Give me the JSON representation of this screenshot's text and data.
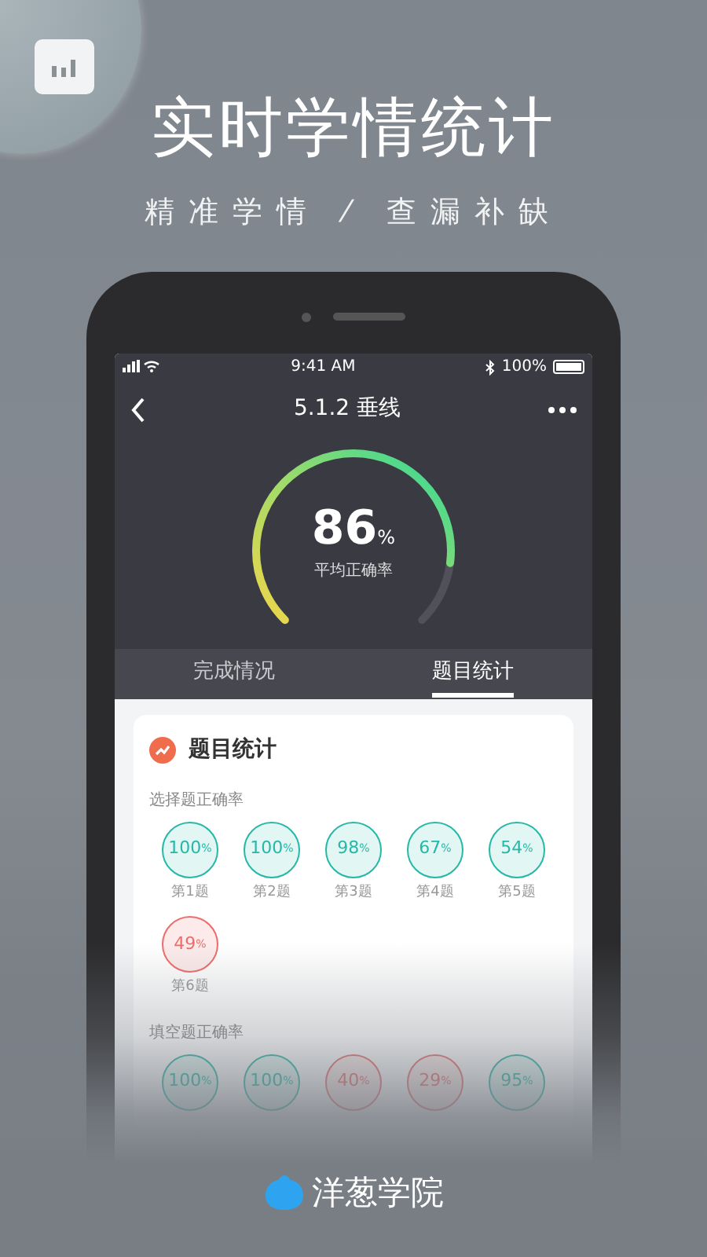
{
  "hero": {
    "title": "实时学情统计",
    "subtitle": "精准学情 ⁄ 查漏补缺"
  },
  "status_bar": {
    "time": "9:41 AM",
    "battery": "100%"
  },
  "nav": {
    "title": "5.1.2 垂线"
  },
  "gauge": {
    "value": "86",
    "unit": "%",
    "label": "平均正确率"
  },
  "tabs": [
    {
      "label": "完成情况",
      "selected": false
    },
    {
      "label": "题目统计",
      "selected": true
    }
  ],
  "card": {
    "title": "题目统计",
    "sections": [
      {
        "label": "选择题正确率",
        "items": [
          {
            "value": "100",
            "unit": "%",
            "label": "第1题",
            "kind": "good"
          },
          {
            "value": "100",
            "unit": "%",
            "label": "第2题",
            "kind": "good"
          },
          {
            "value": "98",
            "unit": "%",
            "label": "第3题",
            "kind": "good"
          },
          {
            "value": "67",
            "unit": "%",
            "label": "第4题",
            "kind": "good"
          },
          {
            "value": "54",
            "unit": "%",
            "label": "第5题",
            "kind": "good"
          },
          {
            "value": "49",
            "unit": "%",
            "label": "第6题",
            "kind": "poor"
          }
        ]
      },
      {
        "label": "填空题正确率",
        "items": [
          {
            "value": "100",
            "unit": "%",
            "kind": "good"
          },
          {
            "value": "100",
            "unit": "%",
            "kind": "good"
          },
          {
            "value": "40",
            "unit": "%",
            "kind": "poor"
          },
          {
            "value": "29",
            "unit": "%",
            "kind": "poor"
          },
          {
            "value": "95",
            "unit": "%",
            "kind": "good"
          }
        ]
      }
    ]
  },
  "brand": {
    "name": "洋葱学院"
  }
}
